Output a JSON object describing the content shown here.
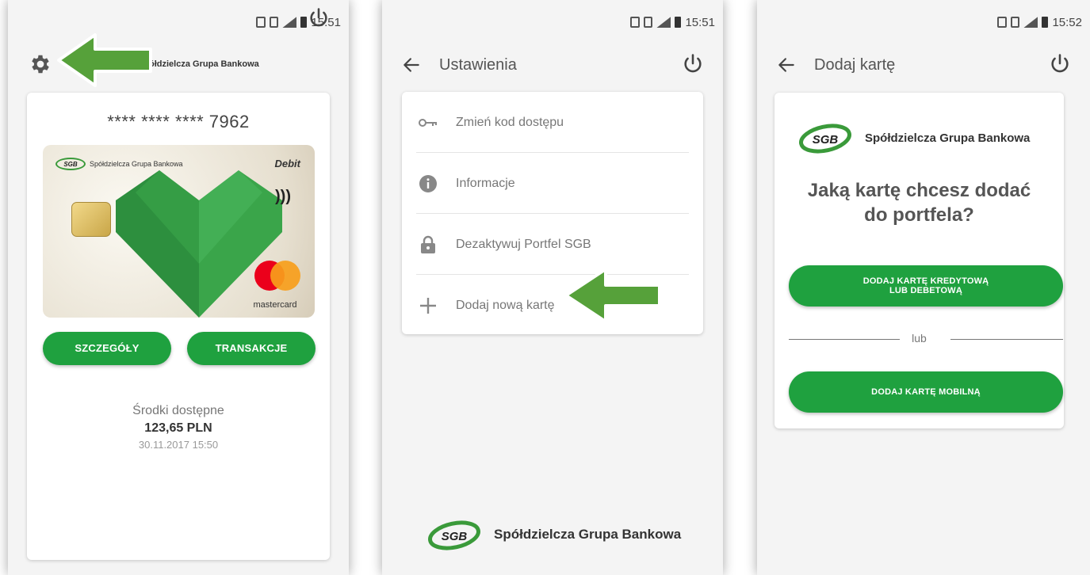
{
  "status": {
    "time_1": "15:51",
    "time_2": "15:51",
    "time_3": "15:52"
  },
  "screen_wallet": {
    "bank_name_partial": "ółdzielcza Grupa Bankowa",
    "masked_card_number": "**** **** **** 7962",
    "card": {
      "logo_text": "SGB",
      "bank_name": "Spółdzielcza Grupa Bankowa",
      "type_label": "Debit",
      "network": "mastercard"
    },
    "details_button": "SZCZEGÓŁY",
    "transactions_button": "TRANSAKCJE",
    "funds_label": "Środki dostępne",
    "funds_amount": "123,65 PLN",
    "funds_date": "30.11.2017 15:50"
  },
  "screen_settings": {
    "title": "Ustawienia",
    "menu_items": [
      {
        "label": "Zmień kod dostępu",
        "icon": "key-icon"
      },
      {
        "label": "Informacje",
        "icon": "info-icon"
      },
      {
        "label": "Dezaktywuj Portfel SGB",
        "icon": "lock-icon"
      },
      {
        "label": "Dodaj nową kartę",
        "icon": "plus-icon"
      }
    ],
    "footer_logo_text": "SGB",
    "footer_bank_name": "Spółdzielcza Grupa Bankowa"
  },
  "screen_add_card": {
    "title": "Dodaj kartę",
    "logo_text": "SGB",
    "bank_name": "Spółdzielcza Grupa Bankowa",
    "question_line1": "Jaką kartę chcesz dodać",
    "question_line2": "do portfela?",
    "add_credit_button_line1": "DODAJ KARTĘ KREDYTOWĄ",
    "add_credit_button_line2": "LUB DEBETOWĄ",
    "or_label": "lub",
    "add_mobile_button": "DODAJ KARTĘ MOBILNĄ"
  },
  "colors": {
    "brand_green": "#1fa13f",
    "arrow_green": "#56a13a"
  }
}
